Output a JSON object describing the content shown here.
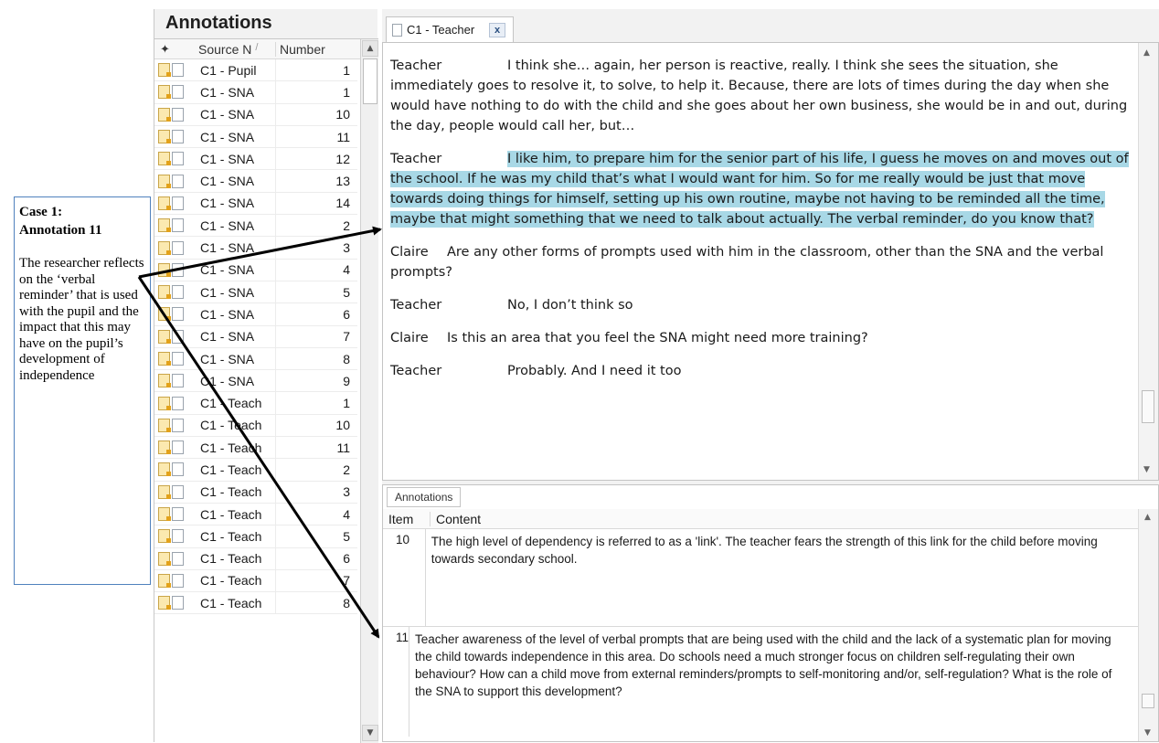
{
  "callout": {
    "title_line1": "Case 1:",
    "title_line2": "Annotation 11",
    "body": "The researcher reflects on the ‘verbal reminder’ that is used with the pupil and the impact that this may have on the pupil’s development of independence"
  },
  "annotations_panel": {
    "heading": "Annotations",
    "columns": {
      "source": "Source N",
      "number": "Number"
    },
    "rows": [
      {
        "source": "C1 -  Pupil",
        "number": "1"
      },
      {
        "source": "C1 - SNA",
        "number": "1"
      },
      {
        "source": "C1 - SNA",
        "number": "10"
      },
      {
        "source": "C1 - SNA",
        "number": "11"
      },
      {
        "source": "C1 - SNA",
        "number": "12"
      },
      {
        "source": "C1 - SNA",
        "number": "13"
      },
      {
        "source": "C1 - SNA",
        "number": "14"
      },
      {
        "source": "C1 - SNA",
        "number": "2"
      },
      {
        "source": "C1 - SNA",
        "number": "3"
      },
      {
        "source": "C1 - SNA",
        "number": "4"
      },
      {
        "source": "C1 - SNA",
        "number": "5"
      },
      {
        "source": "C1 - SNA",
        "number": "6"
      },
      {
        "source": "C1 - SNA",
        "number": "7"
      },
      {
        "source": "C1 - SNA",
        "number": "8"
      },
      {
        "source": "C1 - SNA",
        "number": "9"
      },
      {
        "source": "C1 - Teach",
        "number": "1"
      },
      {
        "source": "C1 - Teach",
        "number": "10"
      },
      {
        "source": "C1 - Teach",
        "number": "11"
      },
      {
        "source": "C1 - Teach",
        "number": "2"
      },
      {
        "source": "C1 - Teach",
        "number": "3"
      },
      {
        "source": "C1 - Teach",
        "number": "4"
      },
      {
        "source": "C1 - Teach",
        "number": "5"
      },
      {
        "source": "C1 - Teach",
        "number": "6"
      },
      {
        "source": "C1 - Teach",
        "number": "7"
      },
      {
        "source": "C1 - Teach",
        "number": "8"
      }
    ]
  },
  "document": {
    "tab_label": "C1 - Teacher",
    "close_symbol": "x",
    "paragraphs": [
      {
        "speaker": "Teacher",
        "text": "I think she… again, her person is reactive, really. I think she sees the situation, she immediately goes to resolve it, to solve, to help it. Because, there are lots of times during the day when she would have nothing to do with the child and she goes about her own business, she would be in and out, during the day, people would call her, but…"
      },
      {
        "speaker": "Teacher",
        "text": "I like him, to prepare him for the senior part of his life, I guess he moves on and moves out of the school. If he was my child that’s what I would want for him. So for me really would be just that move towards doing things for himself, setting up his own routine, maybe not having to be reminded all the time, maybe that might something that we need to talk about actually. The verbal reminder, do you know that?"
      },
      {
        "speaker": "Claire",
        "text": "Are any other forms of prompts used with him in the classroom, other than the SNA and the verbal prompts?"
      },
      {
        "speaker": "Teacher",
        "text": "No, I don’t think so"
      },
      {
        "speaker": "Claire",
        "text": "Is this an area that you feel the SNA might need more training?"
      },
      {
        "speaker": "Teacher",
        "text": "Probably. And I need it too"
      }
    ]
  },
  "annotation_pane": {
    "tab_label": "Annotations",
    "columns": {
      "item": "Item",
      "content": "Content"
    },
    "entries": [
      {
        "item": "10",
        "content": "The high level of dependency is referred to as a 'link'. The teacher fears the strength of this link for the child before moving towards secondary school."
      },
      {
        "item": "11",
        "content": "Teacher awareness of the level of verbal prompts that are being used with the child and the lack of a systematic plan for moving the child towards independence in this area. Do schools need a much stronger focus on children self-regulating their own behaviour? How can a child move from external reminders/prompts to self-monitoring and/or, self-regulation? What is the role of the SNA to support this development?"
      }
    ]
  },
  "colors": {
    "highlight": "#a8d8e6",
    "callout_border": "#4f81bd",
    "arrow": "#000000"
  }
}
